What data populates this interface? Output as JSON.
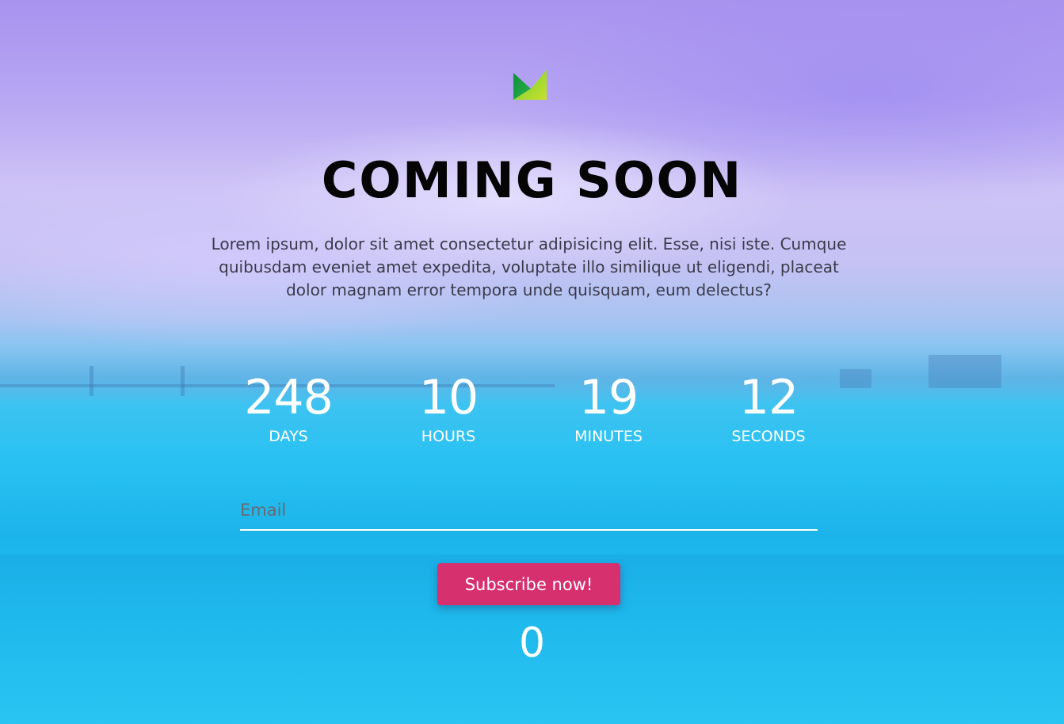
{
  "brand": {
    "logo_icon": "m-chevron-logo-icon",
    "logo_colors": [
      "#1f9a3a",
      "#a8d82a"
    ]
  },
  "hero": {
    "title": "COMING SOON",
    "description": "Lorem ipsum, dolor sit amet consectetur adipisicing elit. Esse, nisi iste. Cumque quibusdam eveniet amet expedita, voluptate illo similique ut eligendi, placeat dolor magnam error tempora unde quisquam, eum delectus?"
  },
  "countdown": {
    "items": [
      {
        "value": "248",
        "label": "DAYS"
      },
      {
        "value": "10",
        "label": "HOURS"
      },
      {
        "value": "19",
        "label": "MINUTES"
      },
      {
        "value": "12",
        "label": "SECONDS"
      }
    ]
  },
  "form": {
    "email_placeholder": "Email",
    "email_value": "",
    "subscribe_label": "Subscribe now!",
    "subscriber_count": "0"
  },
  "colors": {
    "button": "#d6306e",
    "title": "#050505",
    "countdown_text": "#ffffff"
  }
}
